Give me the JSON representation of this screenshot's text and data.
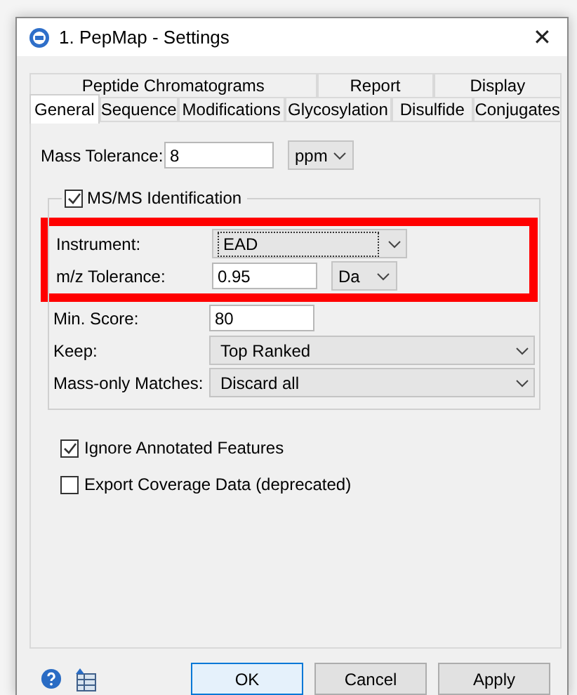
{
  "window": {
    "title": "1. PepMap - Settings",
    "close": "✕"
  },
  "tabs": [
    [
      {
        "label": "Peptide Chromatograms",
        "selected": false
      },
      {
        "label": "Report",
        "selected": false
      },
      {
        "label": "Display",
        "selected": false
      }
    ],
    [
      {
        "label": "General",
        "selected": true
      },
      {
        "label": "Sequence",
        "selected": false
      },
      {
        "label": "Modifications",
        "selected": false
      },
      {
        "label": "Glycosylation",
        "selected": false
      },
      {
        "label": "Disulfide",
        "selected": false
      },
      {
        "label": "Conjugates",
        "selected": false
      }
    ]
  ],
  "mass_tolerance": {
    "label": "Mass Tolerance:",
    "value": "8",
    "unit": "ppm"
  },
  "msms": {
    "label": "MS/MS Identification",
    "checked": true,
    "rows": [
      {
        "kind": "select",
        "label": "Instrument:",
        "value": "EAD",
        "focused": true,
        "highlighted": true
      },
      {
        "kind": "text",
        "label": "m/z Tolerance:",
        "value": "0.95",
        "unit": "Da",
        "highlighted": true
      },
      {
        "kind": "text",
        "label": "Min. Score:",
        "value": "80",
        "highlighted": false
      },
      {
        "kind": "select",
        "label": "Keep:",
        "value": "Top Ranked",
        "focused": false,
        "highlighted": false
      },
      {
        "kind": "select",
        "label": "Mass-only Matches:",
        "value": "Discard all",
        "focused": false,
        "highlighted": false
      }
    ]
  },
  "options": [
    {
      "label": "Ignore Annotated Features",
      "checked": true
    },
    {
      "label": "Export Coverage Data (deprecated)",
      "checked": false
    }
  ],
  "buttons": [
    {
      "label": "OK",
      "default": true
    },
    {
      "label": "Cancel",
      "default": false
    },
    {
      "label": "Apply",
      "default": false
    }
  ]
}
